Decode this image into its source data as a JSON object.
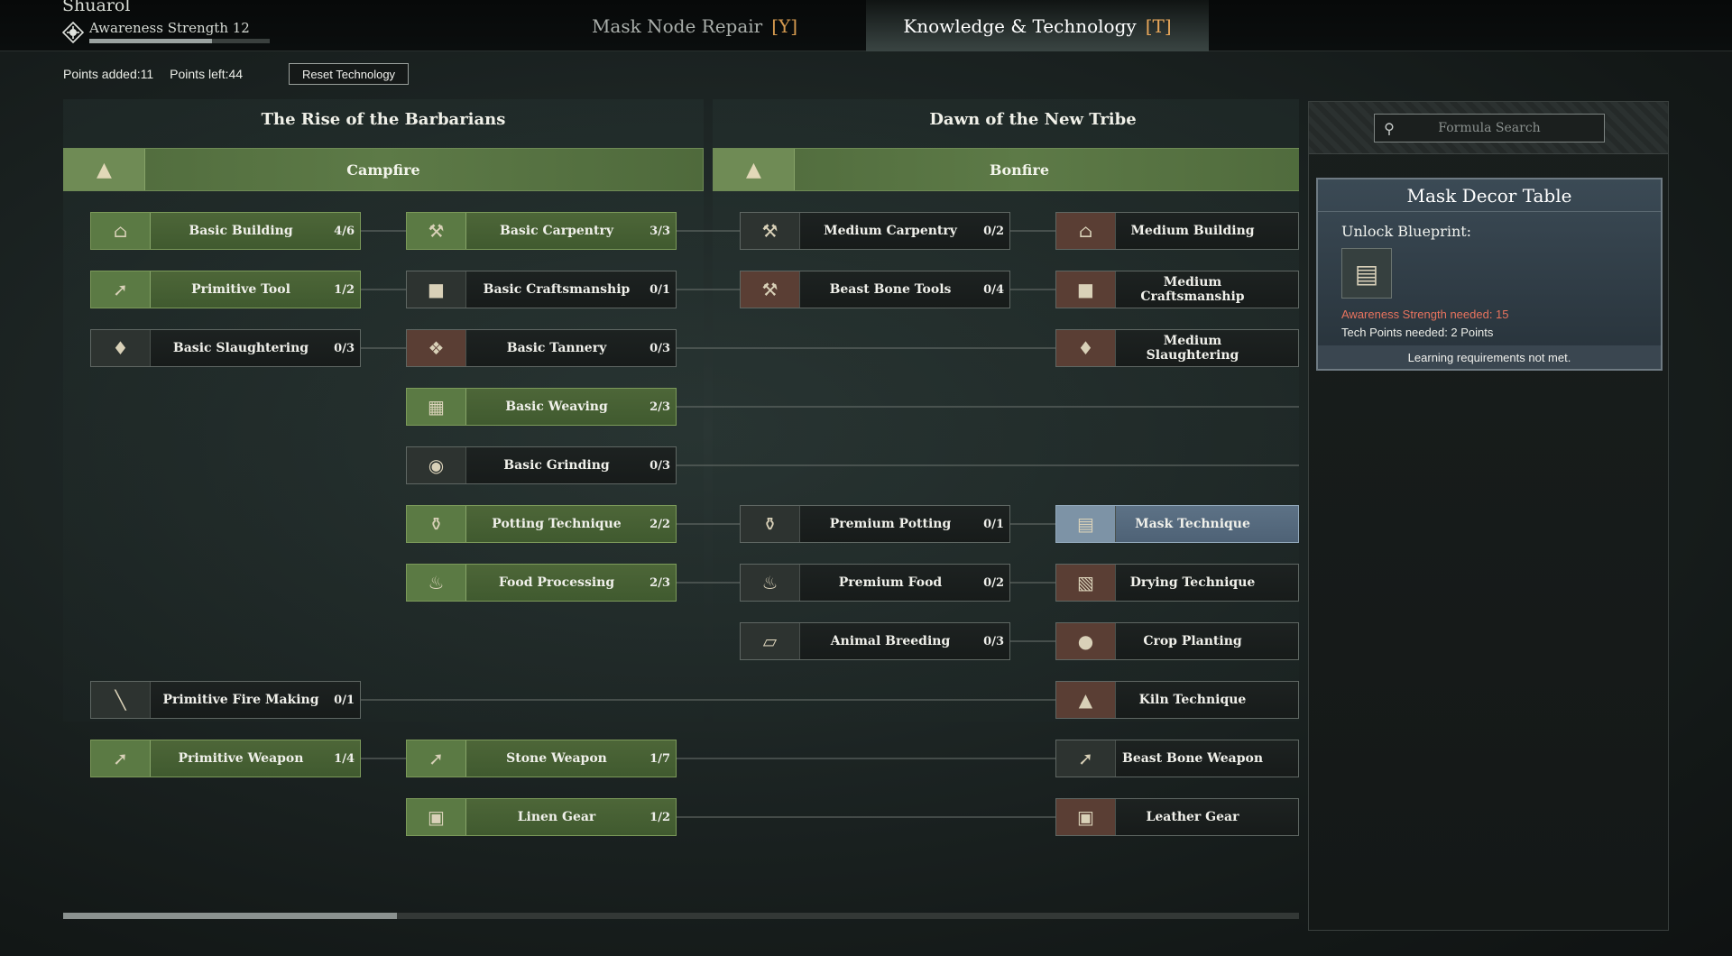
{
  "player": {
    "name": "Shuarol",
    "awareness_label": "Awareness Strength 12",
    "awareness_progress": 0.68
  },
  "tabs": [
    {
      "label": "Mask Node Repair",
      "hotkey": "[Y]"
    },
    {
      "label": "Knowledge & Technology",
      "hotkey": "[T]"
    }
  ],
  "points": {
    "added": "Points added:11",
    "left": "Points left:44",
    "reset_label": "Reset Technology"
  },
  "eras": [
    {
      "title": "The Rise of the Barbarians",
      "header": "Campfire",
      "icon": "campfire-icon"
    },
    {
      "title": "Dawn of the New Tribe",
      "header": "Bonfire",
      "icon": "bonfire-icon"
    }
  ],
  "nodes": [
    {
      "label": "Basic Building",
      "count": "4/6",
      "icon": "house-icon",
      "state": "green"
    },
    {
      "label": "Basic Carpentry",
      "count": "3/3",
      "icon": "saw-icon",
      "state": "green"
    },
    {
      "label": "Medium Carpentry",
      "count": "0/2",
      "icon": "saw-icon",
      "state": "locked"
    },
    {
      "label": "Medium Building",
      "count": "",
      "icon": "house-icon",
      "state": "brown"
    },
    {
      "label": "Primitive Tool",
      "count": "1/2",
      "icon": "axe-icon",
      "state": "green"
    },
    {
      "label": "Basic Craftsmanship",
      "count": "0/1",
      "icon": "anvil-icon",
      "state": "locked"
    },
    {
      "label": "Beast Bone Tools",
      "count": "0/4",
      "icon": "pickaxe-icon",
      "state": "brown"
    },
    {
      "label": "Medium Craftsmanship",
      "count": "",
      "icon": "anvil-icon",
      "state": "brown"
    },
    {
      "label": "Basic Slaughtering",
      "count": "0/3",
      "icon": "boar-icon",
      "state": "locked"
    },
    {
      "label": "Basic Tannery",
      "count": "0/3",
      "icon": "hide-icon",
      "state": "brown"
    },
    {
      "label": "Medium Slaughtering",
      "count": "",
      "icon": "boar-icon",
      "state": "brown"
    },
    {
      "label": "Basic Weaving",
      "count": "2/3",
      "icon": "loom-icon",
      "state": "green"
    },
    {
      "label": "Basic Grinding",
      "count": "0/3",
      "icon": "millstone-icon",
      "state": "locked"
    },
    {
      "label": "Potting Technique",
      "count": "2/2",
      "icon": "pot-icon",
      "state": "green"
    },
    {
      "label": "Premium Potting",
      "count": "0/1",
      "icon": "pot-icon",
      "state": "locked"
    },
    {
      "label": "Mask Technique",
      "count": "",
      "icon": "mask-table-icon",
      "state": "selected"
    },
    {
      "label": "Food Processing",
      "count": "2/3",
      "icon": "food-icon",
      "state": "green"
    },
    {
      "label": "Premium Food",
      "count": "0/2",
      "icon": "food-icon",
      "state": "locked"
    },
    {
      "label": "Drying Technique",
      "count": "",
      "icon": "rack-icon",
      "state": "brown"
    },
    {
      "label": "Animal Breeding",
      "count": "0/3",
      "icon": "pen-icon",
      "state": "locked"
    },
    {
      "label": "Crop Planting",
      "count": "",
      "icon": "sack-icon",
      "state": "brown"
    },
    {
      "label": "Primitive Fire Making",
      "count": "0/1",
      "icon": "torch-icon",
      "state": "locked"
    },
    {
      "label": "Kiln Technique",
      "count": "",
      "icon": "kiln-icon",
      "state": "brown"
    },
    {
      "label": "Primitive Weapon",
      "count": "1/4",
      "icon": "spear-icon",
      "state": "green"
    },
    {
      "label": "Stone Weapon",
      "count": "1/7",
      "icon": "spear-icon",
      "state": "green"
    },
    {
      "label": "Beast Bone Weapon",
      "count": "",
      "icon": "spear-icon",
      "state": "locked"
    },
    {
      "label": "Linen Gear",
      "count": "1/2",
      "icon": "tunic-icon",
      "state": "green"
    },
    {
      "label": "Leather Gear",
      "count": "",
      "icon": "armor-icon",
      "state": "brown"
    }
  ],
  "search": {
    "placeholder": "Formula Search"
  },
  "detail": {
    "title": "Mask Decor Table",
    "unlock_label": "Unlock Blueprint:",
    "awareness_req": "Awareness Strength needed: 15",
    "tech_req": "Tech Points needed: 2 Points",
    "note": "Learning requirements not met.",
    "req_color": "#e8735e"
  },
  "scroll_progress": 0.27
}
